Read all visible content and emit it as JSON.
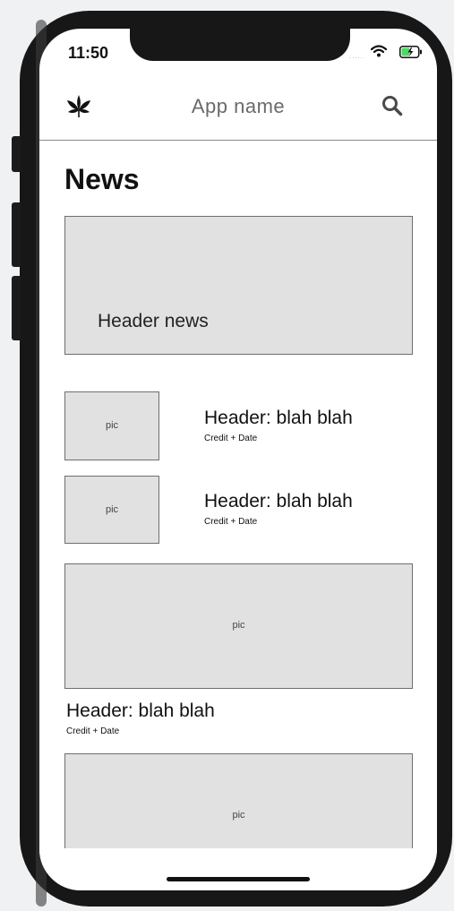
{
  "status_bar": {
    "time": "11:50",
    "signal_dots": "....."
  },
  "nav": {
    "app_name": "App name",
    "logo_icon": "leaf-icon",
    "search_icon": "search-icon"
  },
  "page": {
    "title": "News"
  },
  "featured": {
    "headline": "Header news"
  },
  "articles": [
    {
      "pic": "pic",
      "headline": "Header: blah blah",
      "credit": "Credit + Date"
    },
    {
      "pic": "pic",
      "headline": "Header: blah blah",
      "credit": "Credit + Date"
    }
  ],
  "large_articles": [
    {
      "pic": "pic",
      "headline": "Header: blah blah",
      "credit": "Credit + Date"
    },
    {
      "pic": "pic"
    }
  ]
}
